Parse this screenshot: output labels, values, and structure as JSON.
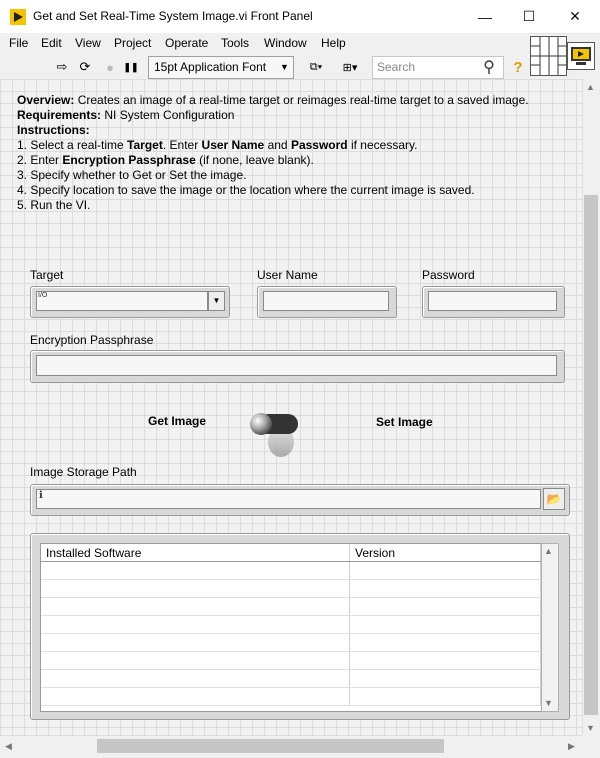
{
  "window": {
    "title": "Get and Set Real-Time System Image.vi Front Panel",
    "minimize_glyph": "—",
    "maximize_glyph": "☐",
    "close_glyph": "✕"
  },
  "menu": [
    "File",
    "Edit",
    "View",
    "Project",
    "Operate",
    "Tools",
    "Window",
    "Help"
  ],
  "toolbar": {
    "run_glyph": "⇨",
    "run_continuously_glyph": "⟳",
    "abort_glyph": "●",
    "pause_glyph": "❚❚",
    "font_ring_value": "15pt Application Font",
    "align_glyph": "⧉▾",
    "distribute_glyph": "⊞▾",
    "search_placeholder": "Search",
    "search_glyph": "⚲",
    "help_glyph": "?"
  },
  "description": {
    "overview_label": "Overview:",
    "overview_text": "Creates an image of a real-time target or reimages real-time target to a saved image.",
    "requirements_label": "Requirements:",
    "requirements_text": "NI System Configuration",
    "instructions_label": "Instructions:",
    "step1_a": "1. Select a real-time ",
    "step1_b": "Target",
    "step1_c": ". Enter ",
    "step1_d": "User Name",
    "step1_e": " and ",
    "step1_f": "Password",
    "step1_g": " if necessary.",
    "step2_a": "2. Enter ",
    "step2_b": "Encryption Passphrase",
    "step2_c": " (if none, leave blank).",
    "step3": "3. Specify whether to Get or Set the image.",
    "step4": "4. Specify location to save the image or the location where the current image is saved.",
    "step5": "5. Run the VI."
  },
  "controls": {
    "target_label": "Target",
    "target_value": "",
    "target_io_glyph": "I/O",
    "user_name_label": "User Name",
    "user_name_value": "",
    "password_label": "Password",
    "password_value": "",
    "passphrase_label": "Encryption Passphrase",
    "passphrase_value": "",
    "get_image_label": "Get Image",
    "set_image_label": "Set Image",
    "toggle_state": "Get Image",
    "storage_path_label": "Image Storage Path",
    "storage_path_value": "",
    "browse_glyph": "📂"
  },
  "software_table": {
    "columns": [
      "Installed Software",
      "Version"
    ],
    "rows": [
      [
        "",
        ""
      ],
      [
        "",
        ""
      ],
      [
        "",
        ""
      ],
      [
        "",
        ""
      ],
      [
        "",
        ""
      ],
      [
        "",
        ""
      ],
      [
        "",
        ""
      ],
      [
        "",
        ""
      ]
    ],
    "scroll_up_glyph": "▲",
    "scroll_down_glyph": "▼"
  },
  "scrollbars": {
    "up_glyph": "▲",
    "down_glyph": "▼",
    "left_glyph": "◀",
    "right_glyph": "▶"
  }
}
